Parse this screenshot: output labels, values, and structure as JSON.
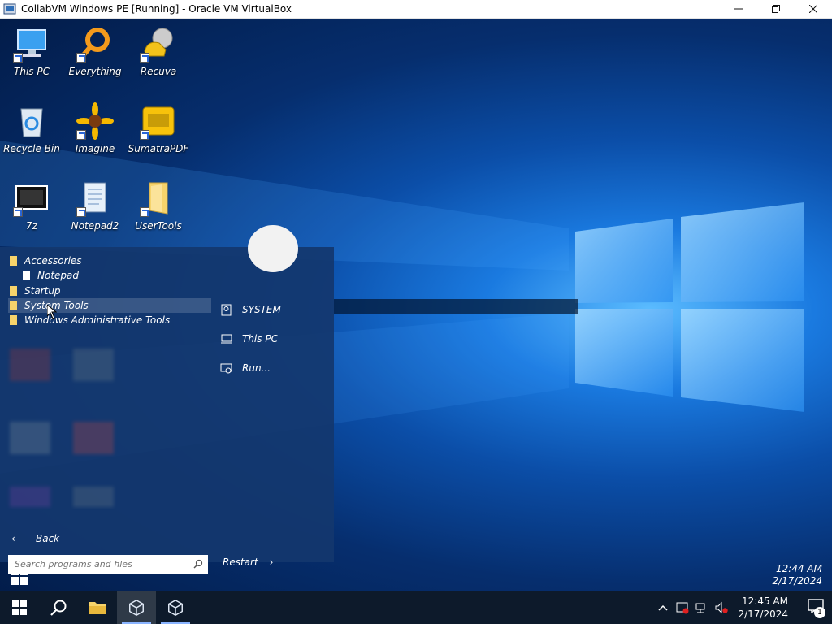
{
  "window": {
    "title": "CollabVM Windows PE [Running] - Oracle VM VirtualBox",
    "minimize_icon": "minimize-icon",
    "maximize_icon": "restore-icon",
    "close_icon": "close-icon"
  },
  "desktop": {
    "icons": [
      {
        "label": "This PC",
        "icon": "computer-icon"
      },
      {
        "label": "Everything",
        "icon": "everything-search-icon"
      },
      {
        "label": "Recuva",
        "icon": "recuva-icon"
      },
      {
        "label": "Recycle Bin",
        "icon": "recycle-bin-icon"
      },
      {
        "label": "Imagine",
        "icon": "imagine-icon"
      },
      {
        "label": "SumatraPDF",
        "icon": "sumatrapdf-icon"
      },
      {
        "label": "7z",
        "icon": "7zip-icon"
      },
      {
        "label": "Notepad2",
        "icon": "notepad2-icon"
      },
      {
        "label": "UserTools",
        "icon": "folder-icon"
      }
    ]
  },
  "start_menu": {
    "programs": [
      {
        "label": "Accessories",
        "type": "folder"
      },
      {
        "label": "Notepad",
        "type": "file"
      },
      {
        "label": "Startup",
        "type": "folder"
      },
      {
        "label": "System Tools",
        "type": "folder",
        "selected": true
      },
      {
        "label": "Windows Administrative Tools",
        "type": "folder"
      }
    ],
    "back_label": "Back",
    "search_placeholder": "Search programs and files",
    "right_items": [
      {
        "label": "SYSTEM",
        "icon": "user-icon"
      },
      {
        "label": "This PC",
        "icon": "computer-icon"
      },
      {
        "label": "Run...",
        "icon": "run-icon"
      }
    ],
    "restart_label": "Restart"
  },
  "inner_clock": {
    "time": "12:44 AM",
    "date": "2/17/2024"
  },
  "taskbar": {
    "clock_time": "12:45 AM",
    "clock_date": "2/17/2024",
    "notification_count": "1"
  },
  "colors": {
    "accent": "#0b4ea8",
    "taskbar": "#0d1a2b",
    "folder": "#f6d36b"
  }
}
